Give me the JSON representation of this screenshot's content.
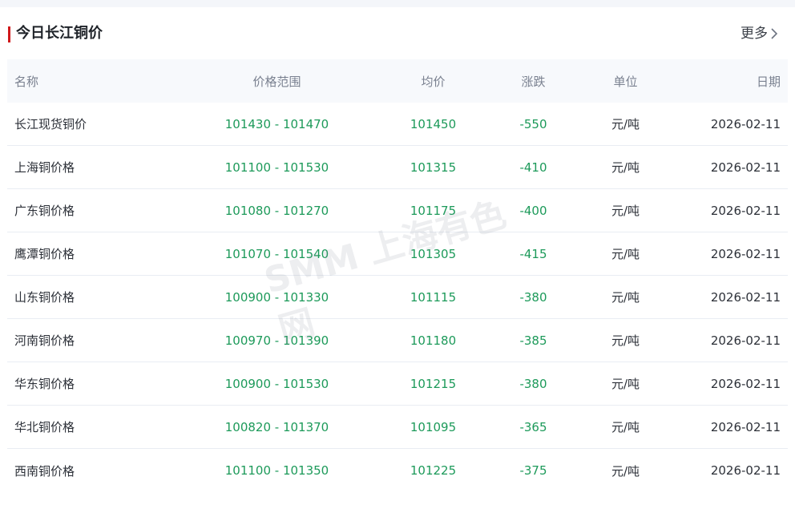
{
  "header": {
    "title": "今日长江铜价",
    "more_label": "更多"
  },
  "table": {
    "columns": {
      "name": "名称",
      "range": "价格范围",
      "avg": "均价",
      "change": "涨跌",
      "unit": "单位",
      "date": "日期"
    },
    "rows": [
      {
        "name": "长江现货铜价",
        "range": "101430 - 101470",
        "avg": "101450",
        "change": "-550",
        "unit": "元/吨",
        "date": "2026-02-11"
      },
      {
        "name": "上海铜价格",
        "range": "101100 - 101530",
        "avg": "101315",
        "change": "-410",
        "unit": "元/吨",
        "date": "2026-02-11"
      },
      {
        "name": "广东铜价格",
        "range": "101080 - 101270",
        "avg": "101175",
        "change": "-400",
        "unit": "元/吨",
        "date": "2026-02-11"
      },
      {
        "name": "鹰潭铜价格",
        "range": "101070 - 101540",
        "avg": "101305",
        "change": "-415",
        "unit": "元/吨",
        "date": "2026-02-11"
      },
      {
        "name": "山东铜价格",
        "range": "100900 - 101330",
        "avg": "101115",
        "change": "-380",
        "unit": "元/吨",
        "date": "2026-02-11"
      },
      {
        "name": "河南铜价格",
        "range": "100970 - 101390",
        "avg": "101180",
        "change": "-385",
        "unit": "元/吨",
        "date": "2026-02-11"
      },
      {
        "name": "华东铜价格",
        "range": "100900 - 101530",
        "avg": "101215",
        "change": "-380",
        "unit": "元/吨",
        "date": "2026-02-11"
      },
      {
        "name": "华北铜价格",
        "range": "100820 - 101370",
        "avg": "101095",
        "change": "-365",
        "unit": "元/吨",
        "date": "2026-02-11"
      },
      {
        "name": "西南铜价格",
        "range": "101100 - 101350",
        "avg": "101225",
        "change": "-375",
        "unit": "元/吨",
        "date": "2026-02-11"
      }
    ]
  },
  "watermark": {
    "text": "SMM 上海有色网"
  },
  "colors": {
    "accent": "#d0191b",
    "price_green": "#1d9a5a",
    "header_bg": "#f7f9fc"
  },
  "icons": {
    "more": "chevron-right-icon"
  }
}
